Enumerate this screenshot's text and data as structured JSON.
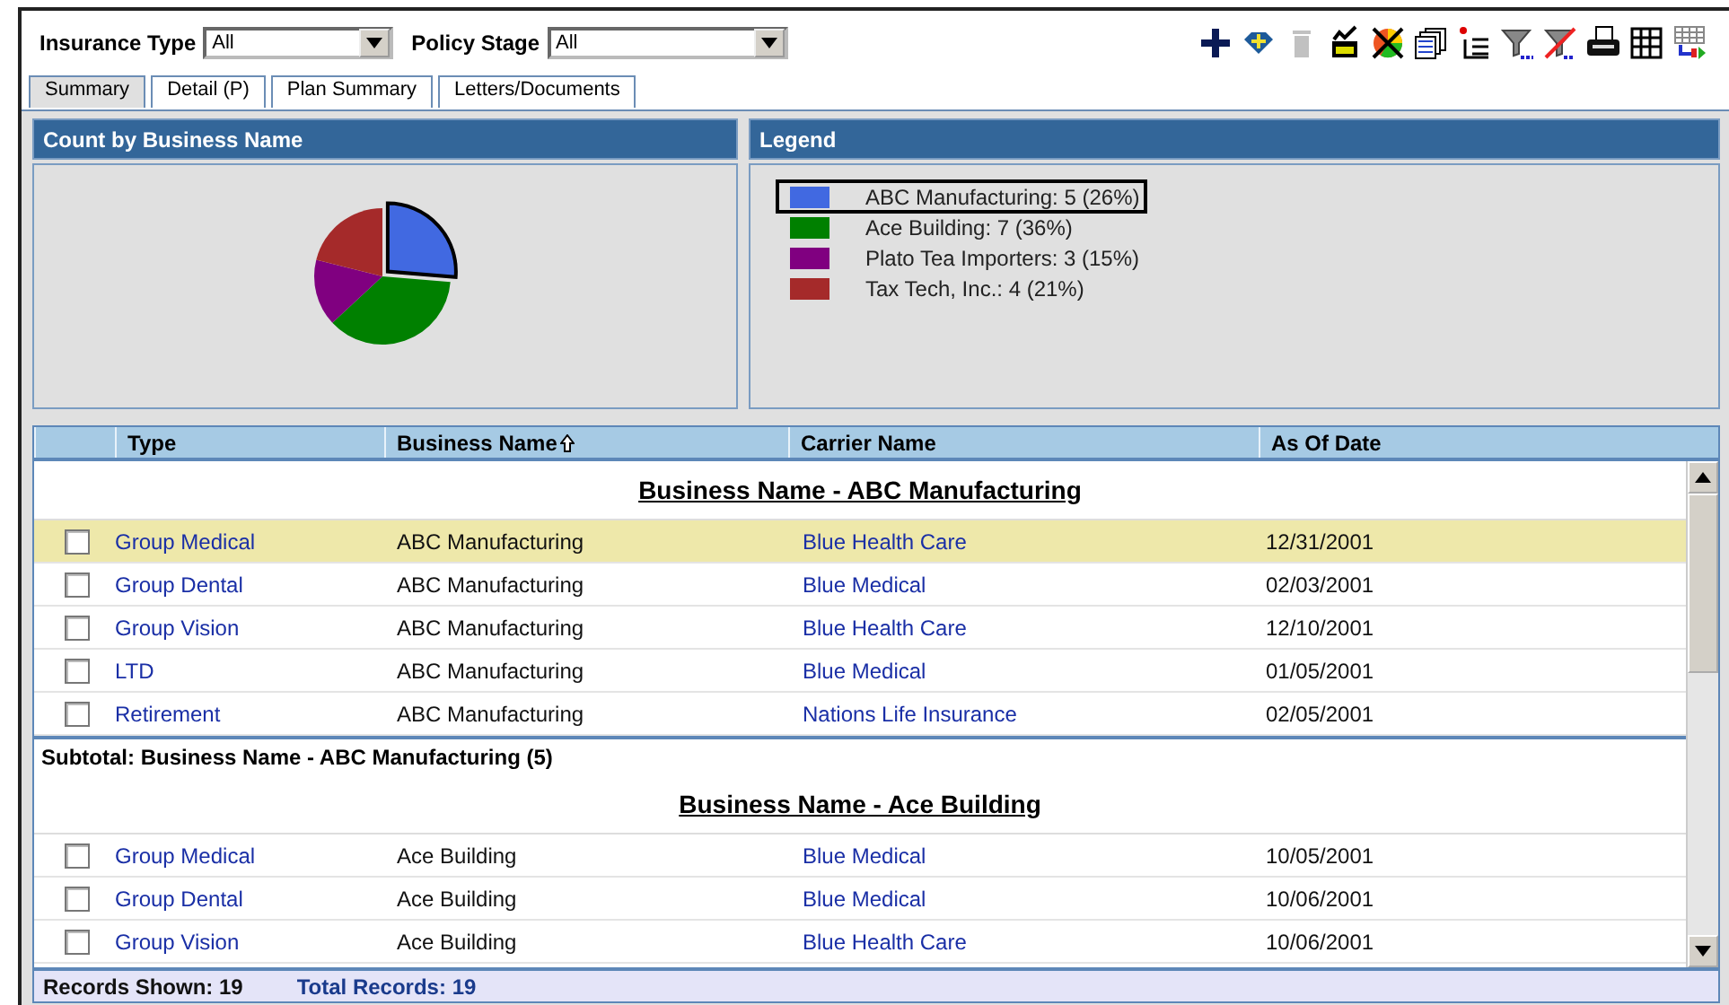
{
  "filters": [
    {
      "label": "Insurance Type",
      "value": "All",
      "kind": "short"
    },
    {
      "label": "Policy Stage",
      "value": "All",
      "kind": "long"
    }
  ],
  "toolbar": [
    {
      "kind": "plus",
      "disabled": false
    },
    {
      "kind": "diamond",
      "disabled": false
    },
    {
      "kind": "trash",
      "disabled": true
    },
    {
      "kind": "check-all",
      "disabled": false
    },
    {
      "kind": "pie-x",
      "disabled": false
    },
    {
      "kind": "pages",
      "disabled": false
    },
    {
      "kind": "new-list",
      "disabled": false
    },
    {
      "kind": "filter",
      "disabled": false
    },
    {
      "kind": "filter-x",
      "disabled": false
    },
    {
      "kind": "printer",
      "disabled": false
    },
    {
      "kind": "grid",
      "disabled": false
    },
    {
      "kind": "grid-export",
      "disabled": false
    }
  ],
  "tabs": [
    {
      "label": "Summary",
      "selected": true
    },
    {
      "label": "Detail (P)",
      "selected": false
    },
    {
      "label": "Plan Summary",
      "selected": false
    },
    {
      "label": "Letters/Documents",
      "selected": false
    }
  ],
  "chart_panel": {
    "title": "Count by Business Name",
    "chart_data": {
      "type": "pie",
      "values": [
        26.3,
        36.8,
        15.8,
        21.1
      ]
    }
  },
  "legend": {
    "title": "Legend",
    "items": [
      {
        "label": "ABC Manufacturing: 5 (26%)",
        "color": "#4169e1",
        "selected": true
      },
      {
        "label": "Ace Building: 7 (36%)",
        "color": "#008000",
        "selected": false
      },
      {
        "label": "Plato Tea Importers: 3 (15%)",
        "color": "#800080",
        "selected": false
      },
      {
        "label": "Tax Tech, Inc.: 4 (21%)",
        "color": "#a52a2a",
        "selected": false
      }
    ]
  },
  "table": {
    "columns": [
      {
        "label": "Type",
        "sorted": false
      },
      {
        "label": "Business Name",
        "sorted": true
      },
      {
        "label": "Carrier Name",
        "sorted": false
      },
      {
        "label": "As Of Date",
        "sorted": false
      }
    ],
    "groups": [
      {
        "heading": "Business Name - ABC Manufacturing",
        "subtotal": "Subtotal: Business Name - ABC Manufacturing (5)",
        "rows": [
          {
            "type": "Group Medical",
            "business": "ABC Manufacturing",
            "carrier": "Blue Health Care",
            "date": "12/31/2001",
            "checked": false,
            "selected": true
          },
          {
            "type": "Group Dental",
            "business": "ABC Manufacturing",
            "carrier": "Blue Medical",
            "date": "02/03/2001",
            "checked": false,
            "selected": false
          },
          {
            "type": "Group Vision",
            "business": "ABC Manufacturing",
            "carrier": "Blue Health Care",
            "date": "12/10/2001",
            "checked": false,
            "selected": false
          },
          {
            "type": "LTD",
            "business": "ABC Manufacturing",
            "carrier": "Blue Medical",
            "date": "01/05/2001",
            "checked": false,
            "selected": false
          },
          {
            "type": "Retirement",
            "business": "ABC Manufacturing",
            "carrier": "Nations Life Insurance",
            "date": "02/05/2001",
            "checked": false,
            "selected": false
          }
        ]
      },
      {
        "heading": "Business Name - Ace Building",
        "rows": [
          {
            "type": "Group Medical",
            "business": "Ace Building",
            "carrier": "Blue Medical",
            "date": "10/05/2001",
            "checked": false,
            "selected": false
          },
          {
            "type": "Group Dental",
            "business": "Ace Building",
            "carrier": "Blue Medical",
            "date": "10/06/2001",
            "checked": false,
            "selected": false
          },
          {
            "type": "Group Vision",
            "business": "Ace Building",
            "carrier": "Blue Health Care",
            "date": "10/06/2001",
            "checked": false,
            "selected": false
          }
        ]
      }
    ]
  },
  "footer": {
    "records_shown": "Records Shown: 19",
    "total_records": "Total Records: 19"
  }
}
